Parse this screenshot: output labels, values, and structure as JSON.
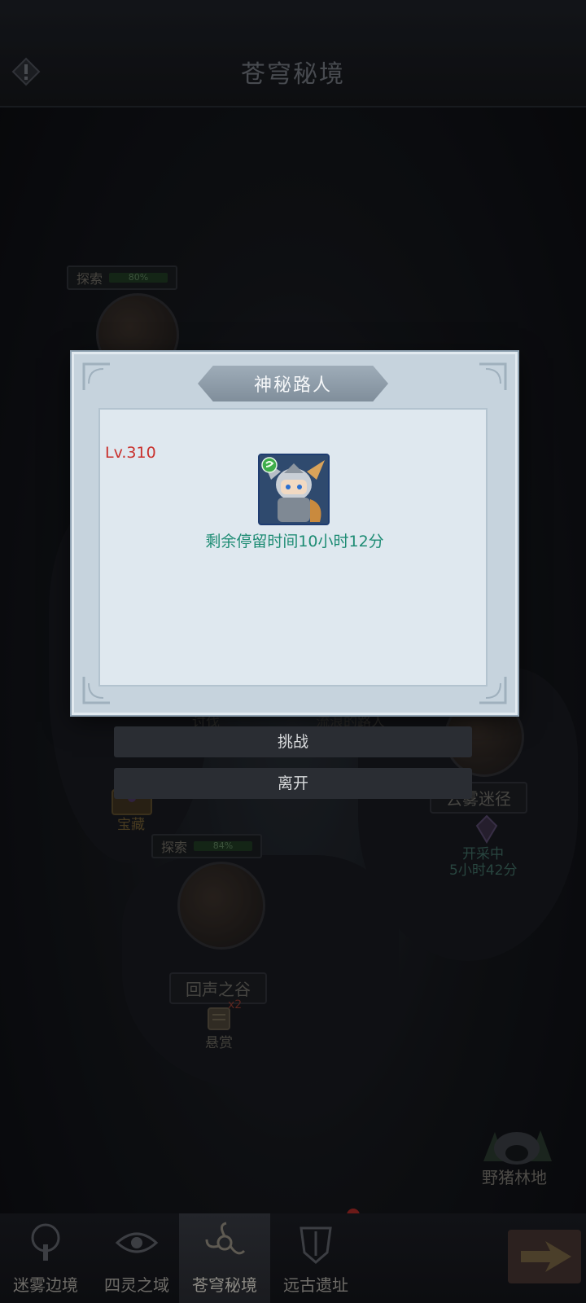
{
  "header": {
    "title": "苍穹秘境"
  },
  "map": {
    "nodes": [
      {
        "name": "云雾迷径",
        "status": "开采中",
        "timer": "5小时42分"
      },
      {
        "name": "回声之谷",
        "explore_label": "探索",
        "explore_progress": "84%",
        "reward_label": "悬赏",
        "reward_multiplier": "x2"
      },
      {
        "name": "野猪林地"
      }
    ],
    "top_node": {
      "explore_label": "探索",
      "explore_progress": "80%"
    },
    "treasure_label": "宝藏",
    "faded_labels": [
      "讨伐",
      "流浪的路人"
    ]
  },
  "dialog": {
    "title": "神秘路人",
    "level": "Lv.310",
    "remaining_time": "剩余停留时间10小时12分",
    "challenge_label": "挑战",
    "leave_label": "离开"
  },
  "bottom_nav": {
    "tabs": [
      {
        "label": "迷雾边境",
        "active": false
      },
      {
        "label": "四灵之域",
        "active": false
      },
      {
        "label": "苍穹秘境",
        "active": true
      },
      {
        "label": "远古遗址",
        "active": false
      }
    ]
  },
  "colors": {
    "level_red": "#c9302c",
    "timer_teal": "#1e8c74",
    "dialog_bg": "#c6d3dd"
  }
}
